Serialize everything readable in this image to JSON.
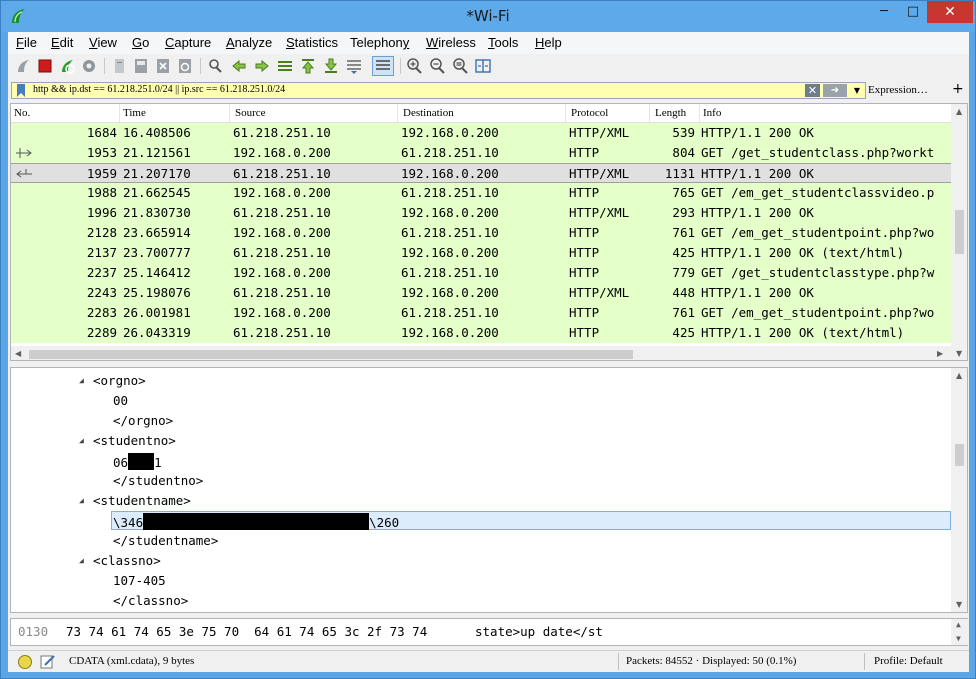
{
  "window": {
    "title": "*Wi-Fi",
    "min": "─",
    "max": "□",
    "close": "✕"
  },
  "menu": [
    "File",
    "Edit",
    "View",
    "Go",
    "Capture",
    "Analyze",
    "Statistics",
    "Telephony",
    "Wireless",
    "Tools",
    "Help"
  ],
  "menu_access": [
    "F",
    "E",
    "V",
    "G",
    "C",
    "A",
    "S",
    "y",
    "W",
    "T",
    "H"
  ],
  "filter": {
    "text": "http && ip.dst == 61.218.251.0/24 || ip.src == 61.218.251.0/24",
    "expression_label": "Expression…",
    "plus_label": "+"
  },
  "packet_list": {
    "columns": [
      "No.",
      "Time",
      "Source",
      "Destination",
      "Protocol",
      "Length",
      "Info"
    ],
    "rows": [
      {
        "no": "1684",
        "time": "16.408506",
        "src": "61.218.251.10",
        "dst": "192.168.0.200",
        "proto": "HTTP/XML",
        "len": "539",
        "info": "HTTP/1.1 200 OK"
      },
      {
        "no": "1953",
        "time": "21.121561",
        "src": "192.168.0.200",
        "dst": "61.218.251.10",
        "proto": "HTTP",
        "len": "804",
        "info": "GET /get_studentclass.php?workt"
      },
      {
        "no": "1959",
        "time": "21.207170",
        "src": "61.218.251.10",
        "dst": "192.168.0.200",
        "proto": "HTTP/XML",
        "len": "1131",
        "info": "HTTP/1.1 200 OK"
      },
      {
        "no": "1988",
        "time": "21.662545",
        "src": "192.168.0.200",
        "dst": "61.218.251.10",
        "proto": "HTTP",
        "len": "765",
        "info": "GET /em_get_studentclassvideo.p"
      },
      {
        "no": "1996",
        "time": "21.830730",
        "src": "61.218.251.10",
        "dst": "192.168.0.200",
        "proto": "HTTP/XML",
        "len": "293",
        "info": "HTTP/1.1 200 OK"
      },
      {
        "no": "2128",
        "time": "23.665914",
        "src": "192.168.0.200",
        "dst": "61.218.251.10",
        "proto": "HTTP",
        "len": "761",
        "info": "GET /em_get_studentpoint.php?wo"
      },
      {
        "no": "2137",
        "time": "23.700777",
        "src": "61.218.251.10",
        "dst": "192.168.0.200",
        "proto": "HTTP",
        "len": "425",
        "info": "HTTP/1.1 200 OK  (text/html)"
      },
      {
        "no": "2237",
        "time": "25.146412",
        "src": "192.168.0.200",
        "dst": "61.218.251.10",
        "proto": "HTTP",
        "len": "779",
        "info": "GET /get_studentclasstype.php?w"
      },
      {
        "no": "2243",
        "time": "25.198076",
        "src": "61.218.251.10",
        "dst": "192.168.0.200",
        "proto": "HTTP/XML",
        "len": "448",
        "info": "HTTP/1.1 200 OK"
      },
      {
        "no": "2283",
        "time": "26.001981",
        "src": "192.168.0.200",
        "dst": "61.218.251.10",
        "proto": "HTTP",
        "len": "761",
        "info": "GET /em_get_studentpoint.php?wo"
      },
      {
        "no": "2289",
        "time": "26.043319",
        "src": "61.218.251.10",
        "dst": "192.168.0.200",
        "proto": "HTTP",
        "len": "425",
        "info": "HTTP/1.1 200 OK  (text/html)"
      }
    ],
    "selected_row": 2,
    "row_color": "#e4ffc7"
  },
  "details": {
    "orgno_open": "<orgno>",
    "orgno_value": "00",
    "orgno_close": "</orgno>",
    "studentno_open": "<studentno>",
    "studentno_prefix": "06",
    "studentno_suffix": "1",
    "studentno_close": "</studentno>",
    "studentname_open": "<studentname>",
    "studentname_prefix": "\\346",
    "studentname_suffix": "\\260",
    "studentname_close": "</studentname>",
    "classno_open": "<classno>",
    "classno_value": "107-405",
    "classno_close": "</classno>"
  },
  "bytes": {
    "offset": "0130",
    "hex": "73 74 61 74 65 3e 75 70  64 61 74 65 3c 2f 73 74",
    "ascii": "state>up date</st"
  },
  "status": {
    "field": "CDATA (xml.cdata), 9 bytes",
    "packets": "Packets: 84552 · Displayed: 50 (0.1%)",
    "profile": "Profile: Default"
  }
}
